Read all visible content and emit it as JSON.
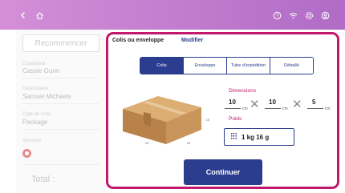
{
  "topbar": {
    "back_icon": "chevron-left-icon",
    "home_icon": "home-icon",
    "help_icon": "help-icon",
    "wifi_icon": "wifi-icon",
    "settings_icon": "gear-icon",
    "account_icon": "account-icon",
    "gradient_start": "#d48fd7",
    "gradient_end": "#b06cc6"
  },
  "sidebar": {
    "restart_label": "Recommencer",
    "sender_label": "Expéditeur",
    "sender_value": "Cassie Gunn",
    "recipient_label": "Destinataire",
    "recipient_value": "Samuel Michaels",
    "parcel_type_label": "Type de colis",
    "parcel_type_value": "Package",
    "services_label": "Services",
    "total_label": "Total :"
  },
  "modal": {
    "title": "Colis ou enveloppe",
    "modify_label": "Modifier",
    "accent_color": "#c2186d",
    "primary_color": "#2b3d8f",
    "tabs": [
      {
        "label": "Colis",
        "active": true
      },
      {
        "label": "Enveloppe",
        "active": false
      },
      {
        "label": "Tube d'expédition",
        "active": false
      },
      {
        "label": "Déballé",
        "active": false
      }
    ],
    "box_dims": {
      "front": "15",
      "depth": "15",
      "height": "15"
    },
    "dimensions_label": "Dimensions",
    "length": "10",
    "width": "10",
    "height": "5",
    "unit": "cm",
    "times_symbol": "✕",
    "weight_label": "Poids",
    "weight_value": "1 kg 16 g",
    "continue_label": "Continuer"
  }
}
